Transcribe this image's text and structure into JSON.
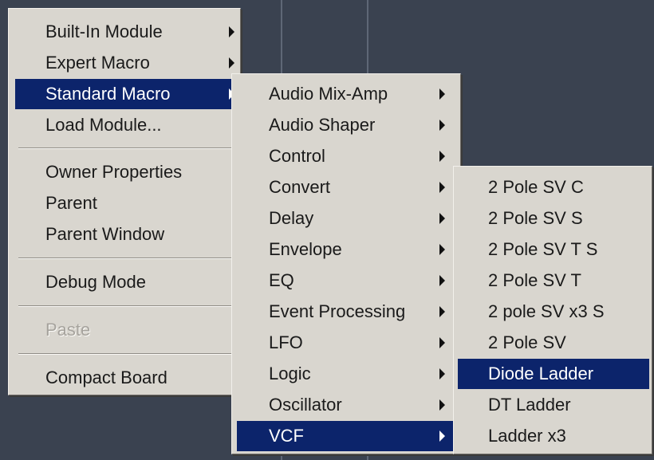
{
  "menu1": {
    "items": [
      {
        "label": "Built-In Module",
        "arrow": true
      },
      {
        "label": "Expert Macro",
        "arrow": true
      },
      {
        "label": "Standard Macro",
        "arrow": true,
        "selected": true
      },
      {
        "label": "Load Module..."
      },
      {
        "label": "Owner Properties"
      },
      {
        "label": "Parent"
      },
      {
        "label": "Parent Window"
      },
      {
        "label": "Debug Mode"
      },
      {
        "label": "Paste",
        "disabled": true
      },
      {
        "label": "Compact Board"
      }
    ]
  },
  "menu2": {
    "items": [
      {
        "label": "Audio Mix-Amp",
        "arrow": true
      },
      {
        "label": "Audio Shaper",
        "arrow": true
      },
      {
        "label": "Control",
        "arrow": true
      },
      {
        "label": "Convert",
        "arrow": true
      },
      {
        "label": "Delay",
        "arrow": true
      },
      {
        "label": "Envelope",
        "arrow": true
      },
      {
        "label": "EQ",
        "arrow": true
      },
      {
        "label": "Event Processing",
        "arrow": true
      },
      {
        "label": "LFO",
        "arrow": true
      },
      {
        "label": "Logic",
        "arrow": true
      },
      {
        "label": "Oscillator",
        "arrow": true
      },
      {
        "label": "VCF",
        "arrow": true,
        "selected": true
      }
    ]
  },
  "menu3": {
    "items": [
      {
        "label": "2 Pole SV C"
      },
      {
        "label": "2 Pole SV S"
      },
      {
        "label": "2 Pole SV T S"
      },
      {
        "label": "2 Pole SV T"
      },
      {
        "label": "2 pole SV x3 S"
      },
      {
        "label": "2 Pole SV"
      },
      {
        "label": "Diode Ladder",
        "selected": true
      },
      {
        "label": "DT Ladder"
      },
      {
        "label": "Ladder x3"
      }
    ]
  }
}
